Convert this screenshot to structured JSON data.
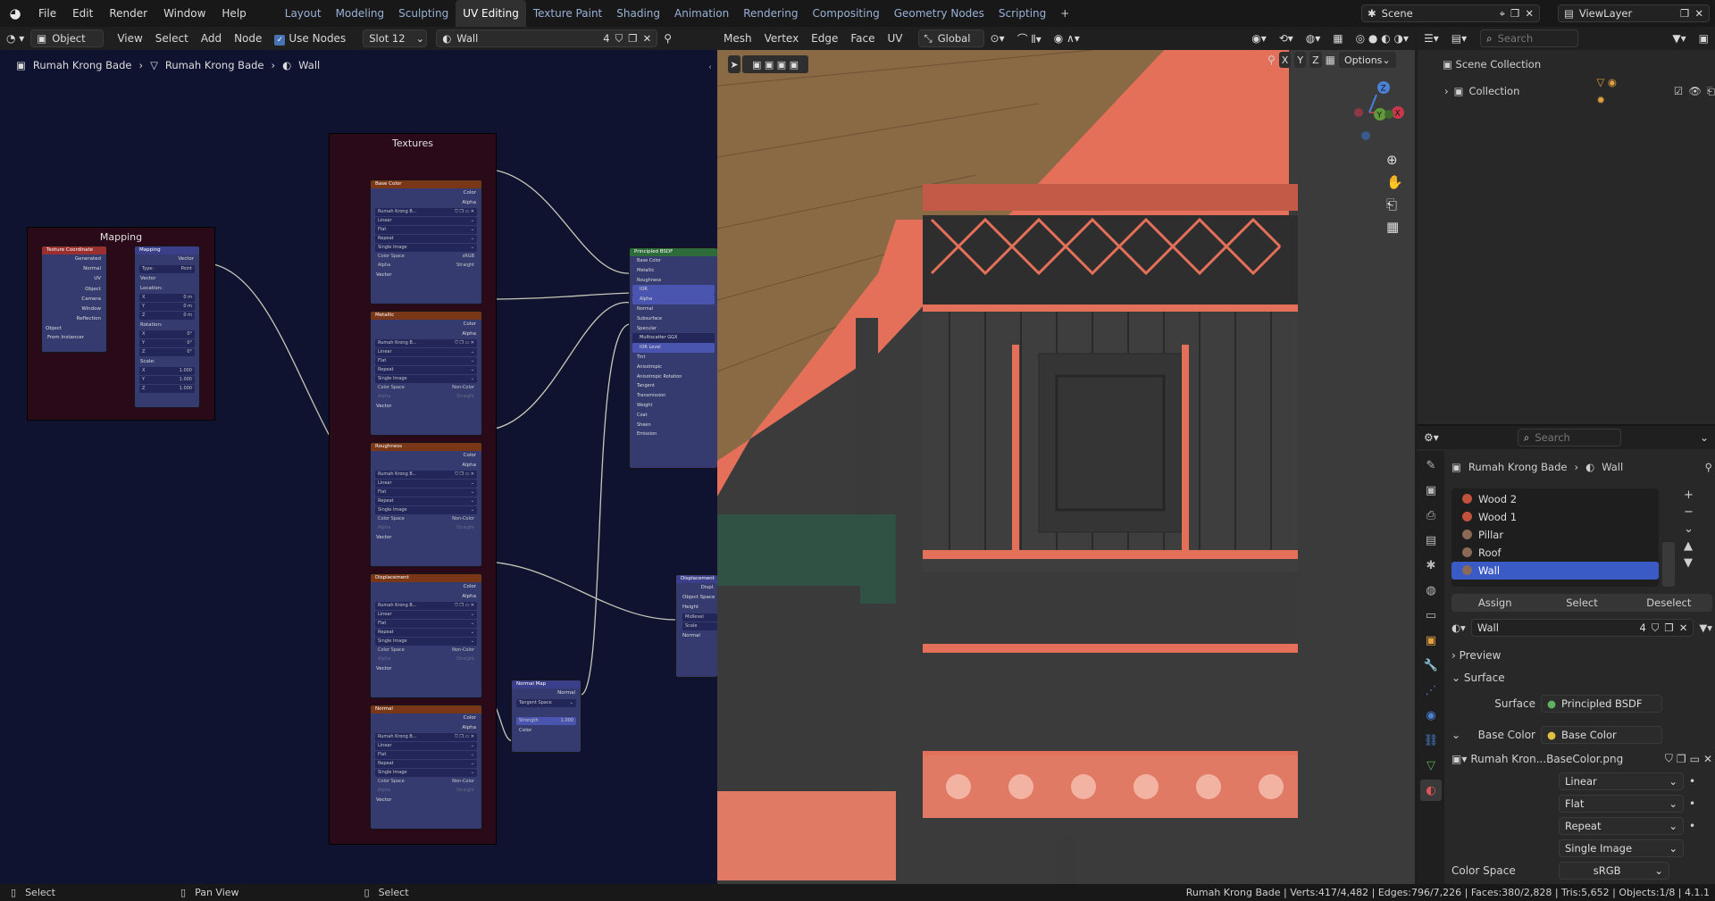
{
  "app": {
    "menus": [
      "File",
      "Edit",
      "Render",
      "Window",
      "Help"
    ],
    "workspaces": [
      "Layout",
      "Modeling",
      "Sculpting",
      "UV Editing",
      "Texture Paint",
      "Shading",
      "Animation",
      "Rendering",
      "Compositing",
      "Geometry Nodes",
      "Scripting"
    ],
    "active_workspace": "UV Editing",
    "plus": "+",
    "scene_label": "Scene",
    "viewlayer_label": "ViewLayer"
  },
  "node_editor": {
    "mode": "Object",
    "menus": [
      "View",
      "Select",
      "Add",
      "Node"
    ],
    "use_nodes_label": "Use Nodes",
    "slot": "Slot 12",
    "material": "Wall",
    "material_users": "4",
    "breadcrumb": [
      "Rumah Krong Bade",
      "Rumah Krong Bade",
      "Wall"
    ],
    "frames": {
      "mapping": "Mapping",
      "textures": "Textures"
    },
    "tex_coord": {
      "title": "Texture Coordinate",
      "outputs": [
        "Generated",
        "Normal",
        "UV",
        "Object",
        "Camera",
        "Window",
        "Reflection"
      ],
      "object_label": "Object",
      "instancer": "From Instancer"
    },
    "mapping": {
      "title": "Mapping",
      "output": "Vector",
      "type_label": "Type:",
      "type_value": "Point",
      "vector_in": "Vector",
      "location": "Location:",
      "loc": [
        "0 m",
        "0 m",
        "0 m"
      ],
      "rotation": "Rotation:",
      "rot": [
        "0°",
        "0°",
        "0°"
      ],
      "scale": "Scale:",
      "scl": [
        "1.000",
        "1.000",
        "1.000"
      ],
      "axes": [
        "X",
        "Y",
        "Z"
      ]
    },
    "image_nodes": [
      {
        "title": "Base Color",
        "image": "Rumah Krong B...",
        "color_space": "sRGB"
      },
      {
        "title": "Metallic",
        "image": "Rumah Krong B...",
        "color_space": "Non-Color"
      },
      {
        "title": "Roughness",
        "image": "Rumah Krong B...",
        "color_space": "Non-Color"
      },
      {
        "title": "Displacement",
        "image": "Rumah Krong B...",
        "color_space": "Non-Color"
      },
      {
        "title": "Normal",
        "image": "Rumah Krong B...",
        "color_space": "Non-Color"
      }
    ],
    "image_node_labels": {
      "color": "Color",
      "alpha": "Alpha",
      "interp": "Linear",
      "proj": "Flat",
      "ext": "Repeat",
      "src": "Single Image",
      "cs": "Color Space",
      "alpha_mode": "Alpha",
      "alpha_val": "Straight",
      "vector": "Vector"
    },
    "bsdf": {
      "title": "Principled BSDF",
      "rows": [
        "Base Color",
        "Metallic",
        "Roughness",
        "IOR",
        "Alpha",
        "Normal",
        "Subsurface",
        "Specular",
        "Multiscatter GGX",
        "IOR Level",
        "Tint",
        "Anisotropic",
        "Anisotropic Rotation",
        "Tangent",
        "Transmission",
        "Weight",
        "Coat",
        "Sheen",
        "Emission"
      ]
    },
    "normal_map": {
      "title": "Normal Map",
      "output": "Normal",
      "space": "Tangent Space",
      "strength_label": "Strength",
      "strength": "1.000",
      "color": "Color"
    },
    "displacement": {
      "title": "Displacement",
      "rows": [
        "Displ.",
        "Object Space",
        "Height",
        "Midlevel",
        "Scale",
        "Normal"
      ]
    }
  },
  "viewport": {
    "menus": [
      "Mesh",
      "Vertex",
      "Edge",
      "Face",
      "UV"
    ],
    "transform": "Global",
    "options": "Options",
    "axes": [
      "X",
      "Y",
      "Z"
    ],
    "gizmo": [
      "X",
      "Y",
      "Z"
    ]
  },
  "outliner": {
    "search_placeholder": "Search",
    "scene_collection": "Scene Collection",
    "collection": "Collection"
  },
  "properties": {
    "search_placeholder": "Search",
    "breadcrumb": [
      "Rumah Krong Bade",
      "Wall"
    ],
    "materials": [
      {
        "name": "Wood 2",
        "color": "#c0513d"
      },
      {
        "name": "Wood 1",
        "color": "#c0513d"
      },
      {
        "name": "Pillar",
        "color": "#8a6a56"
      },
      {
        "name": "Roof",
        "color": "#8a6a56"
      },
      {
        "name": "Wall",
        "color": "#8a6a56"
      }
    ],
    "selected_material": "Wall",
    "buttons": [
      "Assign",
      "Select",
      "Deselect"
    ],
    "material_name": "Wall",
    "material_users": "4",
    "preview": "Preview",
    "surface_section": "Surface",
    "surface_label": "Surface",
    "surface_value": "Principled BSDF",
    "base_color_label": "Base Color",
    "base_color_value": "Base Color",
    "image_name": "Rumah Kron...BaseColor.png",
    "interp": "Linear",
    "proj": "Flat",
    "ext": "Repeat",
    "src": "Single Image",
    "cs_label": "Color Space",
    "cs_value": "sRGB"
  },
  "status": {
    "left": [
      "Select",
      "Pan View",
      "Select"
    ],
    "stats": "Rumah Krong Bade | Verts:417/4,482 | Edges:796/7,226 | Faces:380/2,828 | Tris:5,652 | Objects:1/8 | 4.1.1"
  },
  "colors": {
    "accent": "#4772b3",
    "node_body": "#353b6e",
    "frame": "#2a0a19",
    "tex_header": "#7a3718"
  }
}
